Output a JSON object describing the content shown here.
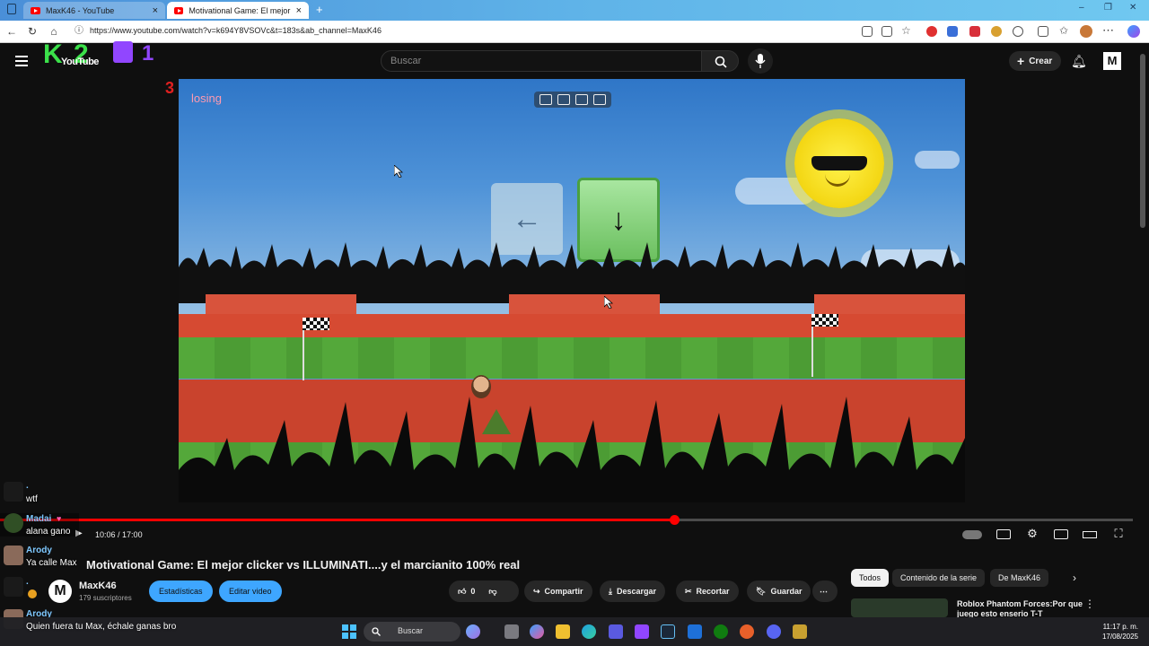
{
  "browser": {
    "tabs": [
      {
        "label": "MaxK46 - YouTube"
      },
      {
        "label": "Motivational Game: El mejor click"
      }
    ],
    "url": "https://www.youtube.com/watch?v=k694Y8VSOVc&t=183s&ab_channel=MaxK46"
  },
  "stream_overlay": {
    "k_counter": "K",
    "k_value": "2",
    "twitch_value": "1",
    "red_value": "3",
    "yt_logo": "YouTube"
  },
  "header": {
    "search_placeholder": "Buscar",
    "create_label": "Crear",
    "avatar_letter": "M"
  },
  "video": {
    "status_text": "losing",
    "key_left": "←",
    "key_down": "↓",
    "time_current": "10:06",
    "time_total": "17:00",
    "time_separator": " / ",
    "progress": 0.595
  },
  "title": {
    "text": "Motivational Game: El mejor clicker vs ILLUMINATI....y el marcianito 100% real"
  },
  "channel": {
    "name": "MaxK46",
    "subscribers": "179 suscriptores",
    "stats_button": "Estadísticas",
    "edit_button": "Editar video"
  },
  "actions": {
    "likes": "0",
    "share": "Compartir",
    "download": "Descargar",
    "clip": "Recortar",
    "save": "Guardar",
    "more": "⋯"
  },
  "chips": {
    "all": "Todos",
    "series": "Contenido de la serie",
    "from_channel": "De MaxK46"
  },
  "related": {
    "title": "Roblox Phantom Forces:Por que juego esto enserio T-T"
  },
  "chat": {
    "messages": [
      {
        "name": ".",
        "text": "wtf"
      },
      {
        "name": "Madai",
        "text": "alana gano"
      },
      {
        "name": "Arody",
        "text": "Ya calle Max"
      },
      {
        "name": ".",
        "text": ""
      },
      {
        "name": "Arody",
        "text": "Quien fuera tu Max, échale ganas bro"
      }
    ]
  },
  "taskbar": {
    "search": "Buscar",
    "time": "11:17 p. m.",
    "date": "17/08/2025"
  },
  "colors": {
    "youtube_red": "#ff0000",
    "accent_blue": "#3ea6ff",
    "chat_name": "#7ec8ff"
  }
}
